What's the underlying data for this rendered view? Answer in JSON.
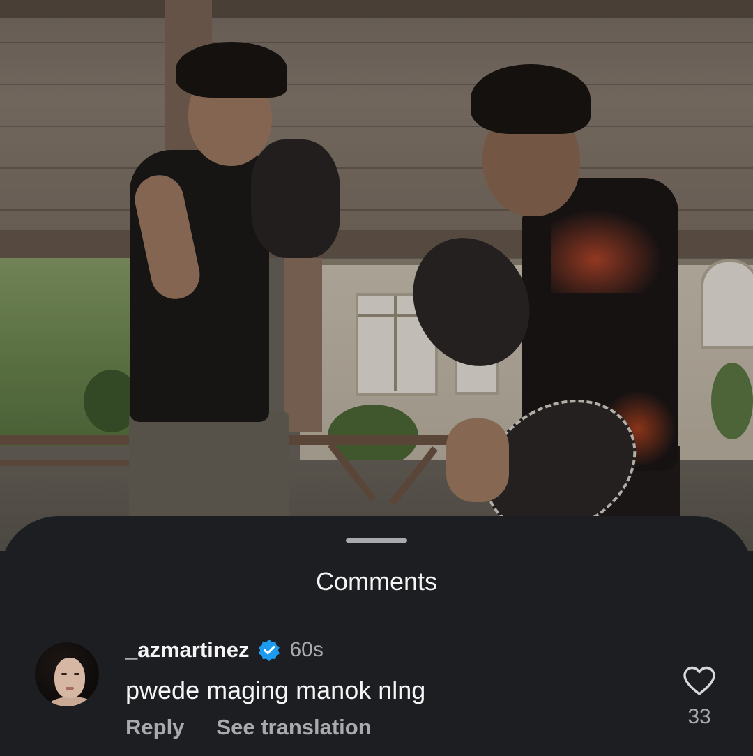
{
  "sheet": {
    "title": "Comments"
  },
  "comment": {
    "username": "_azmartinez",
    "verified": true,
    "timestamp": "60s",
    "text": "pwede maging manok nlng",
    "actions": {
      "reply_label": "Reply",
      "translate_label": "See translation"
    },
    "like_count": "33"
  },
  "icons": {
    "verified": "verified-badge-icon",
    "like": "heart-outline-icon"
  },
  "colors": {
    "sheet_background": "#1c1e21",
    "primary_text": "#f5f5f5",
    "secondary_text": "#a8aaad",
    "verified_blue": "#1d9bf0"
  }
}
